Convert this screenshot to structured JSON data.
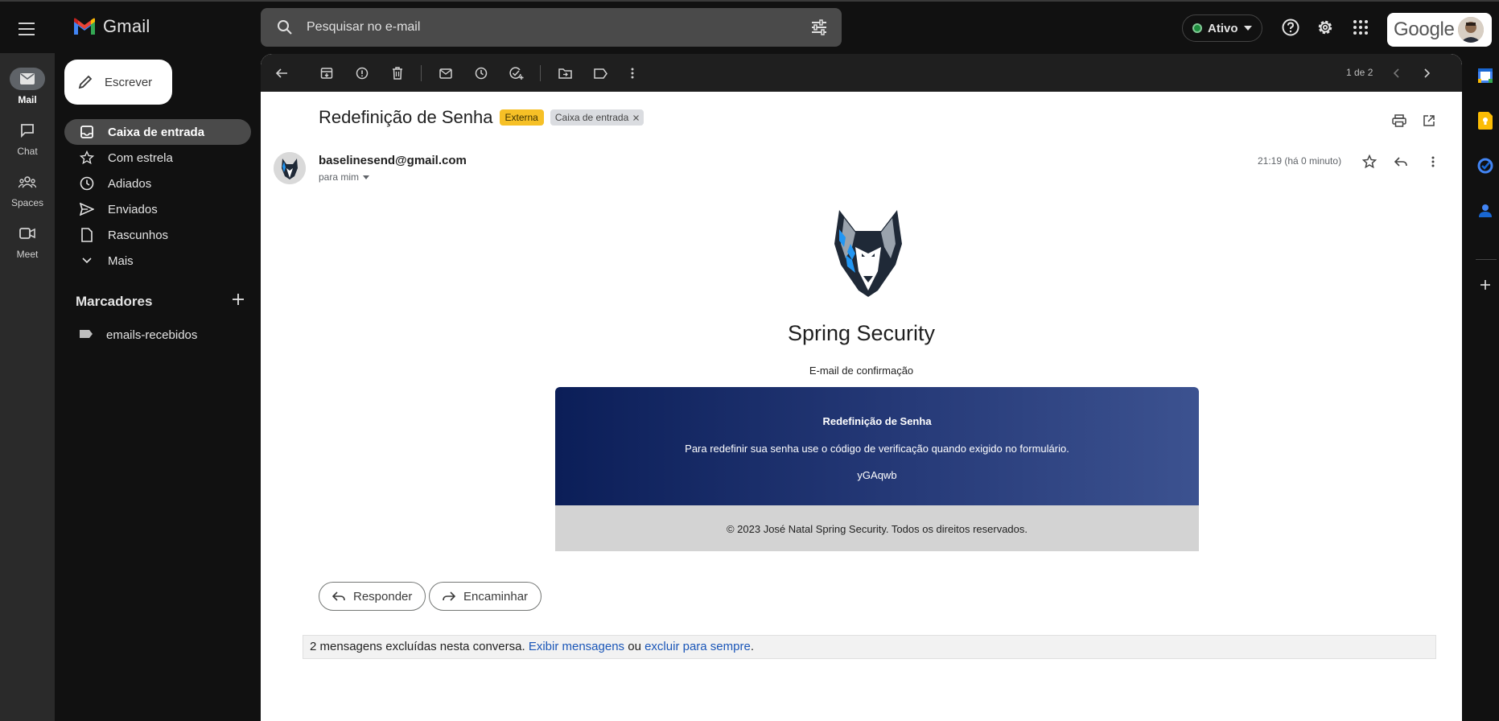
{
  "app": {
    "name": "Gmail",
    "search_placeholder": "Pesquisar no e-mail",
    "status_label": "Ativo",
    "account_brand": "Google"
  },
  "rail": [
    {
      "label": "Mail",
      "icon": "mail-icon",
      "active": true
    },
    {
      "label": "Chat",
      "icon": "chat-icon",
      "active": false
    },
    {
      "label": "Spaces",
      "icon": "spaces-icon",
      "active": false
    },
    {
      "label": "Meet",
      "icon": "meet-icon",
      "active": false
    }
  ],
  "sidebar": {
    "compose_label": "Escrever",
    "items": [
      {
        "label": "Caixa de entrada",
        "icon": "inbox-icon",
        "active": true
      },
      {
        "label": "Com estrela",
        "icon": "star-icon"
      },
      {
        "label": "Adiados",
        "icon": "clock-icon"
      },
      {
        "label": "Enviados",
        "icon": "send-icon"
      },
      {
        "label": "Rascunhos",
        "icon": "draft-icon"
      },
      {
        "label": "Mais",
        "icon": "chevron-down-icon"
      }
    ],
    "labels_heading": "Marcadores",
    "labels": [
      {
        "label": "emails-recebidos",
        "icon": "label-icon"
      }
    ]
  },
  "toolbar": {
    "pager_text": "1 de 2"
  },
  "email": {
    "subject": "Redefinição de Senha",
    "tag_external": "Externa",
    "tag_inbox": "Caixa de entrada",
    "sender": "baselinesend@gmail.com",
    "to": "para mim",
    "time": "21:19 (há 0 minuto)",
    "body": {
      "brand_title": "Spring Security",
      "brand_subtitle": "E-mail de confirmação",
      "card_title": "Redefinição de Senha",
      "card_text": "Para redefinir sua senha use o código de verificação quando exigido no formulário.",
      "code": "yGAqwb",
      "footer": "© 2023 José Natal Spring Security. Todos os direitos reservados."
    },
    "reply_label": "Responder",
    "forward_label": "Encaminhar"
  },
  "notice": {
    "text": "2 mensagens excluídas nesta conversa.",
    "link1": "Exibir mensagens",
    "middle": "ou",
    "link2": "excluir para sempre",
    "end": "."
  },
  "colors": {
    "external_tag": "#f6c026",
    "card_gradient_start": "#0b1e58",
    "card_gradient_end": "#3c5290",
    "link": "#1a56b8",
    "status_green": "#1e8e3e"
  }
}
